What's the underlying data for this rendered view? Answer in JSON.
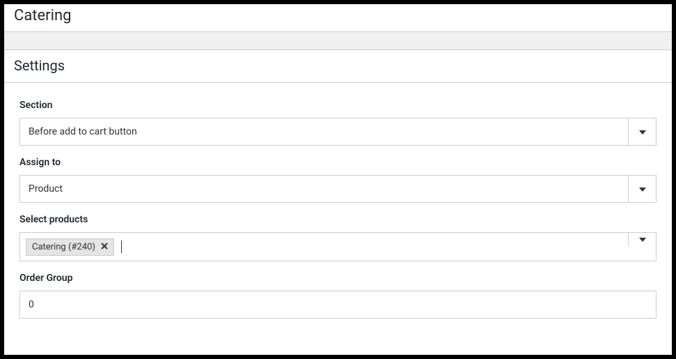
{
  "header": {
    "title": "Catering"
  },
  "panel": {
    "title": "Settings"
  },
  "fields": {
    "section": {
      "label": "Section",
      "value": "Before add to cart button"
    },
    "assign_to": {
      "label": "Assign to",
      "value": "Product"
    },
    "select_products": {
      "label": "Select products",
      "tags": [
        {
          "label": "Catering (#240)"
        }
      ]
    },
    "order_group": {
      "label": "Order Group",
      "value": "0"
    }
  }
}
